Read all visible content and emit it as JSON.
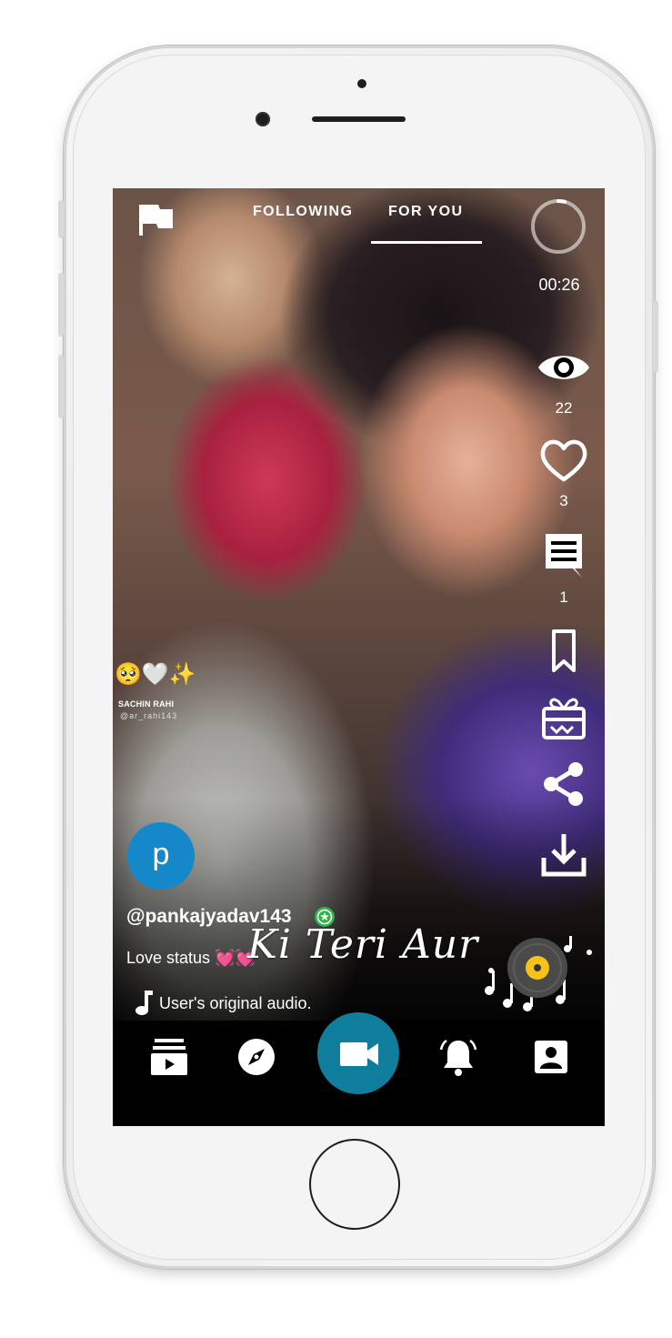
{
  "header": {
    "tab_following": "FOLLOWING",
    "tab_for_you": "FOR YOU",
    "active_tab": "FOR YOU",
    "timer": "00:26",
    "timer_progress": 0.04
  },
  "actions": {
    "views_count": "22",
    "likes_count": "3",
    "comments_count": "1"
  },
  "overlay": {
    "sticker_emoji": "🥺🤍✨",
    "watermark_name": "SACHIN RAHI",
    "watermark_handle": "@ar_rahi143",
    "script_text": "Ki Teri Aur"
  },
  "post": {
    "avatar_letter": "p",
    "username": "@pankajyadav143",
    "caption": "Love status",
    "caption_emoji": "💓💓",
    "audio": "User's original audio."
  },
  "colors": {
    "avatar": "#1488c8",
    "record_button": "#0f7e9c",
    "verified_badge": "#2fb34a",
    "disc_center": "#f4c21b"
  },
  "icons": {
    "top_left": "flag-icon",
    "rail": [
      "eye-icon",
      "heart-icon",
      "comment-icon",
      "bookmark-icon",
      "gift-icon",
      "share-icon",
      "download-icon"
    ],
    "nav": [
      "video-list-icon",
      "compass-icon",
      "video-camera-icon",
      "bell-icon",
      "profile-icon"
    ]
  }
}
